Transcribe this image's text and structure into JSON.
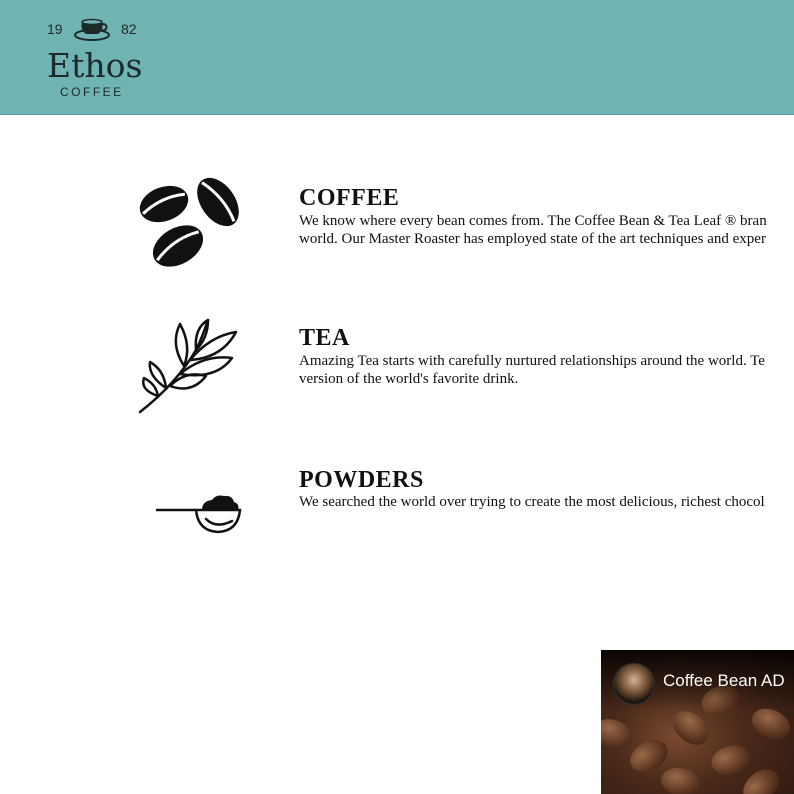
{
  "header": {
    "year_left": "19",
    "year_right": "82",
    "brand": "Ethos",
    "brand_sub": "COFFEE",
    "background": "#6fb3b3"
  },
  "sections": [
    {
      "icon": "coffee-beans-icon",
      "title": "COFFEE",
      "lines": [
        "We know where every bean comes from. The Coffee Bean & Tea Leaf ® bran",
        "world. Our Master Roaster has employed state of the art techniques and exper"
      ]
    },
    {
      "icon": "tea-leaf-icon",
      "title": "TEA",
      "lines": [
        "Amazing Tea starts with carefully nurtured relationships around the world. Te",
        "version of the world's favorite drink."
      ]
    },
    {
      "icon": "powder-scoop-icon",
      "title": "POWDERS",
      "lines": [
        "We searched the world over trying to create the most delicious, richest chocol"
      ]
    }
  ],
  "video": {
    "title": "Coffee Bean AD"
  }
}
